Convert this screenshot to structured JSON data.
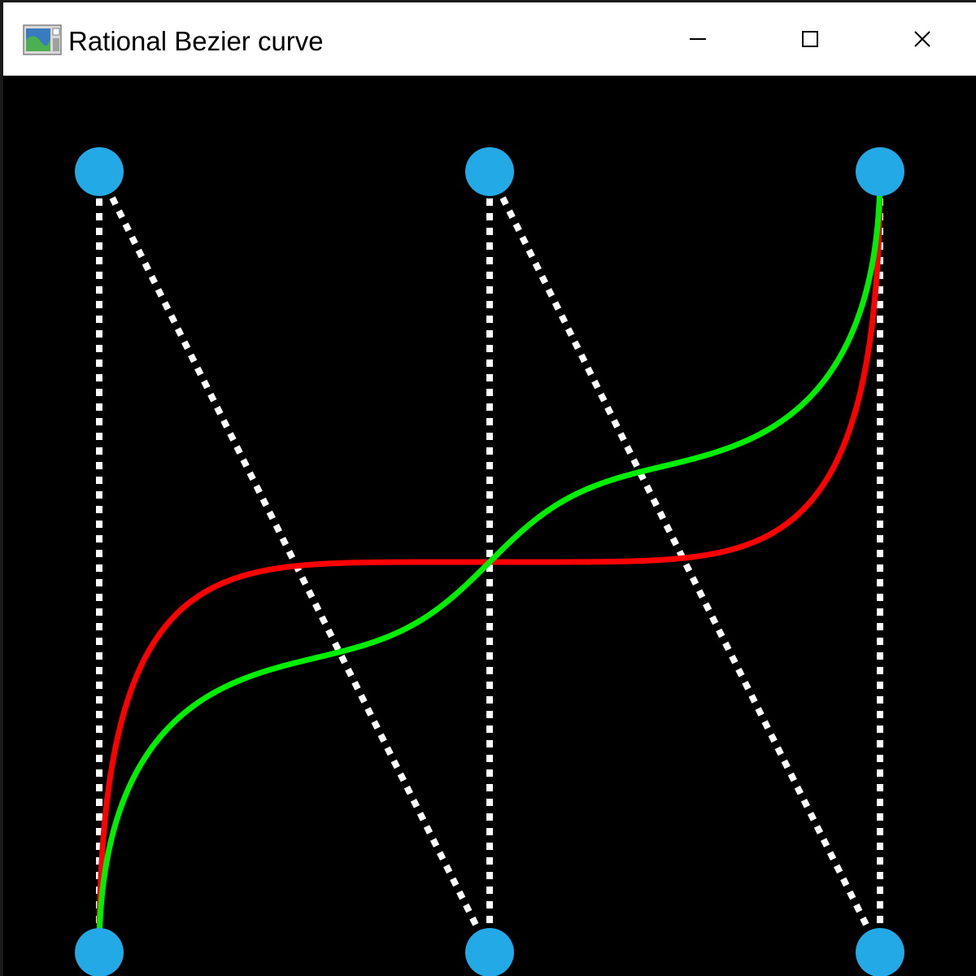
{
  "window": {
    "title": "Rational Bezier curve",
    "app_icon": "app-window-icon",
    "controls": {
      "minimize_icon": "minimize-icon",
      "maximize_icon": "maximize-icon",
      "close_icon": "close-icon"
    }
  },
  "colors": {
    "background": "#000000",
    "control_point": "#22a9e6",
    "control_polygon": "#ffffff",
    "curve_red": "#ff0000",
    "curve_green": "#00ee00"
  },
  "control_points": [
    {
      "id": "p0",
      "x": 0,
      "y": 0
    },
    {
      "id": "p1",
      "x": 0,
      "y": 2
    },
    {
      "id": "p2",
      "x": 1,
      "y": 0
    },
    {
      "id": "p3",
      "x": 1,
      "y": 2
    },
    {
      "id": "p4",
      "x": 2,
      "y": 0
    },
    {
      "id": "p5",
      "x": 2,
      "y": 2
    }
  ],
  "curves": [
    {
      "id": "red-curve",
      "color": "#ff0000",
      "weights": [
        1,
        1,
        1,
        1,
        1,
        1
      ]
    },
    {
      "id": "green-curve",
      "color": "#00ee00",
      "weights": [
        1,
        1,
        3,
        3,
        1,
        1
      ]
    }
  ]
}
